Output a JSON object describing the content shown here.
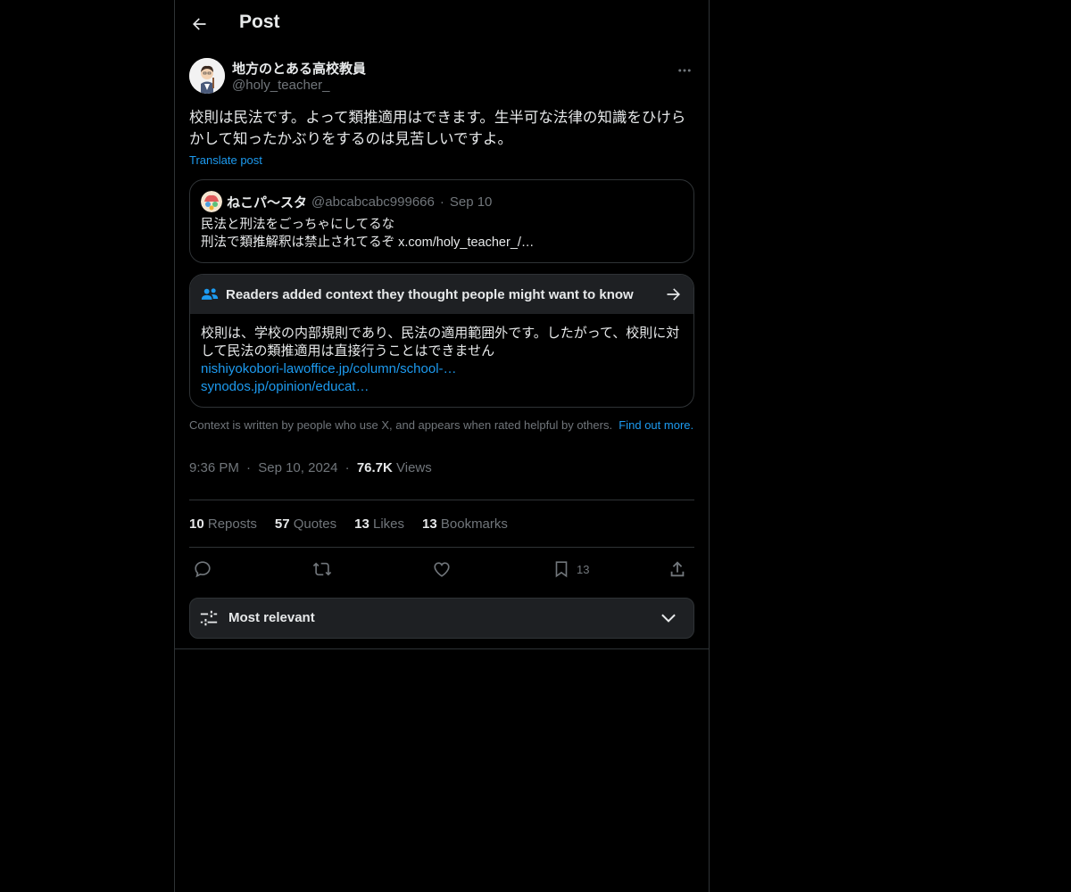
{
  "header": {
    "title": "Post"
  },
  "author": {
    "name": "地方のとある高校教員",
    "handle": "@holy_teacher_"
  },
  "post": {
    "text": "校則は民法です。よって類推適用はできます。生半可な法律の知識をひけらかして知ったかぶりをするのは見苦しいですよ。",
    "translate_label": "Translate post"
  },
  "quote": {
    "name": "ねこパ〜スタ",
    "handle": "@abcabcabc999666",
    "separator": "·",
    "date": "Sep 10",
    "line1": "民法と刑法をごっちゃにしてるな",
    "line2": "刑法で類推解釈は禁止されてるぞ x.com/holy_teacher_/…"
  },
  "community_note": {
    "title": "Readers added context they thought people might want to know",
    "body": "校則は、学校の内部規則であり、民法の適用範囲外です。したがって、校則に対して民法の類推適用は直接行うことはできません",
    "link1": "nishiyokobori-lawoffice.jp/column/school-…",
    "link2": "synodos.jp/opinion/educat…"
  },
  "context_footer": {
    "text": "Context is written by people who use X, and appears when rated helpful by others.",
    "link": "Find out more."
  },
  "meta": {
    "time": "9:36 PM",
    "date": "Sep 10, 2024",
    "separator": "·",
    "views_count": "76.7K",
    "views_label": "Views"
  },
  "stats": [
    {
      "count": "10",
      "label": "Reposts"
    },
    {
      "count": "57",
      "label": "Quotes"
    },
    {
      "count": "13",
      "label": "Likes"
    },
    {
      "count": "13",
      "label": "Bookmarks"
    }
  ],
  "actions": {
    "bookmark_count": "13"
  },
  "sort": {
    "label": "Most relevant"
  },
  "colors": {
    "accent": "#1d9bf0",
    "background": "#000000",
    "muted": "#71767b",
    "border": "#2f3336",
    "note_header": "#1e2023"
  },
  "icons": [
    "back-arrow-icon",
    "more-icon",
    "people-icon",
    "arrow-right-icon",
    "reply-icon",
    "repost-icon",
    "like-icon",
    "bookmark-icon",
    "share-icon",
    "sliders-icon",
    "chevron-down-icon"
  ]
}
